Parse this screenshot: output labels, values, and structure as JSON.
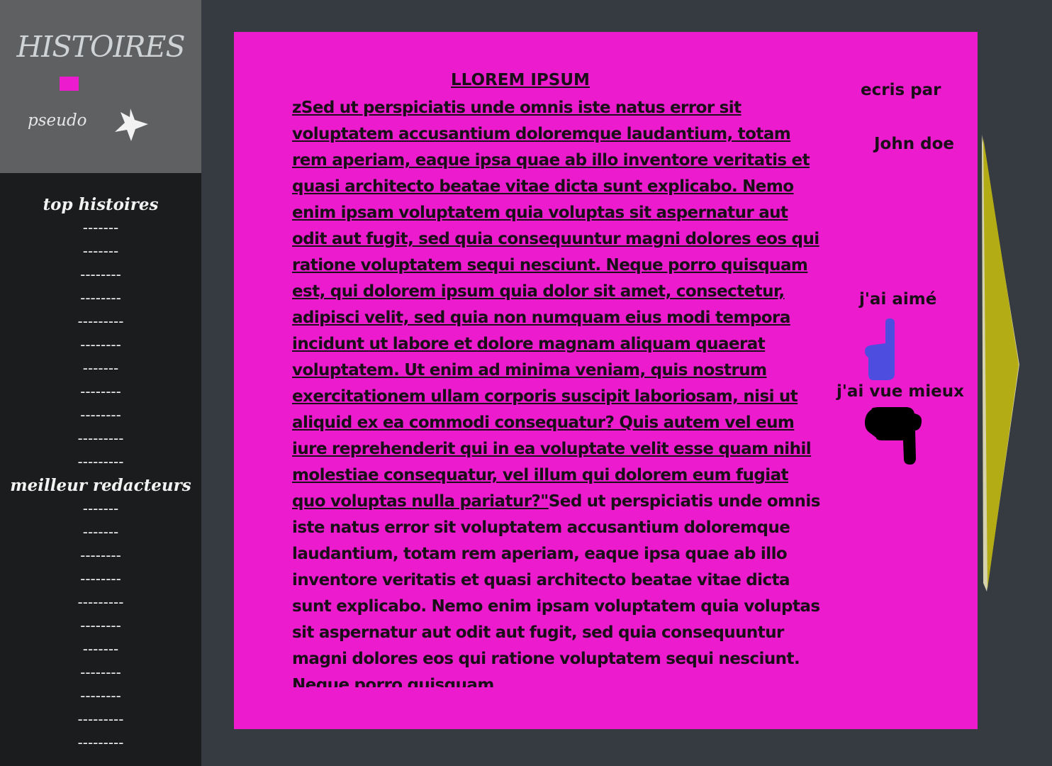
{
  "header": {
    "app_title": "HISTOIRES",
    "user_label": "pseudo",
    "accent_color": "#ec1bce",
    "star_icon": "star-icon"
  },
  "sidebar": {
    "top_stories": {
      "heading": "top histoires",
      "items": [
        "-------",
        "-------",
        "--------",
        "--------",
        "---------",
        "--------",
        "-------",
        "--------",
        "--------",
        "---------",
        "---------"
      ]
    },
    "best_writers": {
      "heading": "meilleur redacteurs",
      "items": [
        "-------",
        "-------",
        "--------",
        "--------",
        "---------",
        "--------",
        "-------",
        "--------",
        "--------",
        "---------",
        "---------"
      ]
    }
  },
  "story": {
    "title": "LLOREM IPSUM",
    "underlined_text": "zSed ut perspiciatis unde omnis iste natus error sit voluptatem accusantium doloremque laudantium, totam rem aperiam, eaque ipsa quae ab illo inventore veritatis et quasi architecto beatae vitae dicta sunt explicabo. Nemo enim ipsam voluptatem quia voluptas sit aspernatur aut odit aut fugit, sed quia consequuntur magni dolores eos qui ratione voluptatem sequi nesciunt. Neque porro quisquam est, qui dolorem ipsum quia dolor sit amet, consectetur, adipisci velit, sed quia non numquam eius modi tempora incidunt ut labore et dolore magnam aliquam quaerat voluptatem. Ut enim ad minima veniam, quis nostrum exercitationem ullam corporis suscipit laboriosam, nisi ut aliquid ex ea commodi consequatur? Quis autem vel eum iure reprehenderit qui in ea voluptate velit esse quam nihil molestiae consequatur, vel illum qui dolorem eum fugiat quo voluptas nulla pariatur?\"",
    "plain_text": "Sed ut perspiciatis unde omnis iste natus error sit voluptatem accusantium doloremque laudantium, totam rem aperiam, eaque ipsa quae ab illo inventore veritatis et quasi architecto beatae vitae dicta sunt explicabo. Nemo enim ipsam voluptatem quia voluptas sit aspernatur aut odit aut fugit, sed quia consequuntur magni dolores eos qui ratione voluptatem sequi nesciunt. Neque porro quisquam",
    "background_color": "#ec1bce"
  },
  "author_panel": {
    "written_by_label": "ecris par",
    "author_name": "John doe",
    "liked_label": "j'ai aimé",
    "disliked_label": "j'ai vue mieux",
    "thumbs_up_color": "#4d4de0",
    "thumbs_down_color": "#000000"
  },
  "navigation": {
    "next_arrow_color": "#b3ac14"
  }
}
